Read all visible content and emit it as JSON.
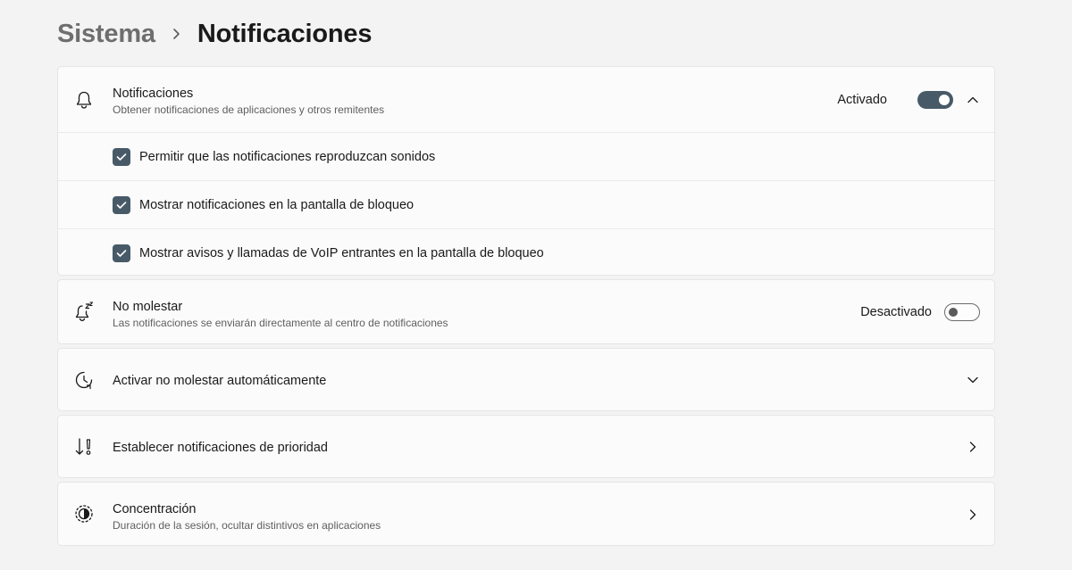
{
  "breadcrumb": {
    "parent": "Sistema",
    "current": "Notificaciones"
  },
  "notifications": {
    "title": "Notificaciones",
    "subtitle": "Obtener notificaciones de aplicaciones y otros remitentes",
    "state_label": "Activado",
    "toggle_on": true,
    "icon": "bell-icon",
    "options": [
      {
        "label": "Permitir que las notificaciones reproduzcan sonidos",
        "checked": true
      },
      {
        "label": "Mostrar notificaciones en la pantalla de bloqueo",
        "checked": true
      },
      {
        "label": "Mostrar avisos y llamadas de VoIP entrantes en la pantalla de bloqueo",
        "checked": true
      }
    ]
  },
  "do_not_disturb": {
    "title": "No molestar",
    "subtitle": "Las notificaciones se enviarán directamente al centro de notificaciones",
    "state_label": "Desactivado",
    "toggle_on": false,
    "icon": "bell-sleep-icon"
  },
  "auto_dnd": {
    "title": "Activar no molestar automáticamente",
    "icon": "clock-icon"
  },
  "priority": {
    "title": "Establecer notificaciones de prioridad",
    "icon": "priority-icon"
  },
  "focus": {
    "title": "Concentración",
    "subtitle": "Duración de la sesión, ocultar distintivos en aplicaciones",
    "icon": "focus-icon"
  },
  "colors": {
    "accent": "#485a68",
    "background": "#f3f3f3",
    "card": "#fbfbfb"
  }
}
